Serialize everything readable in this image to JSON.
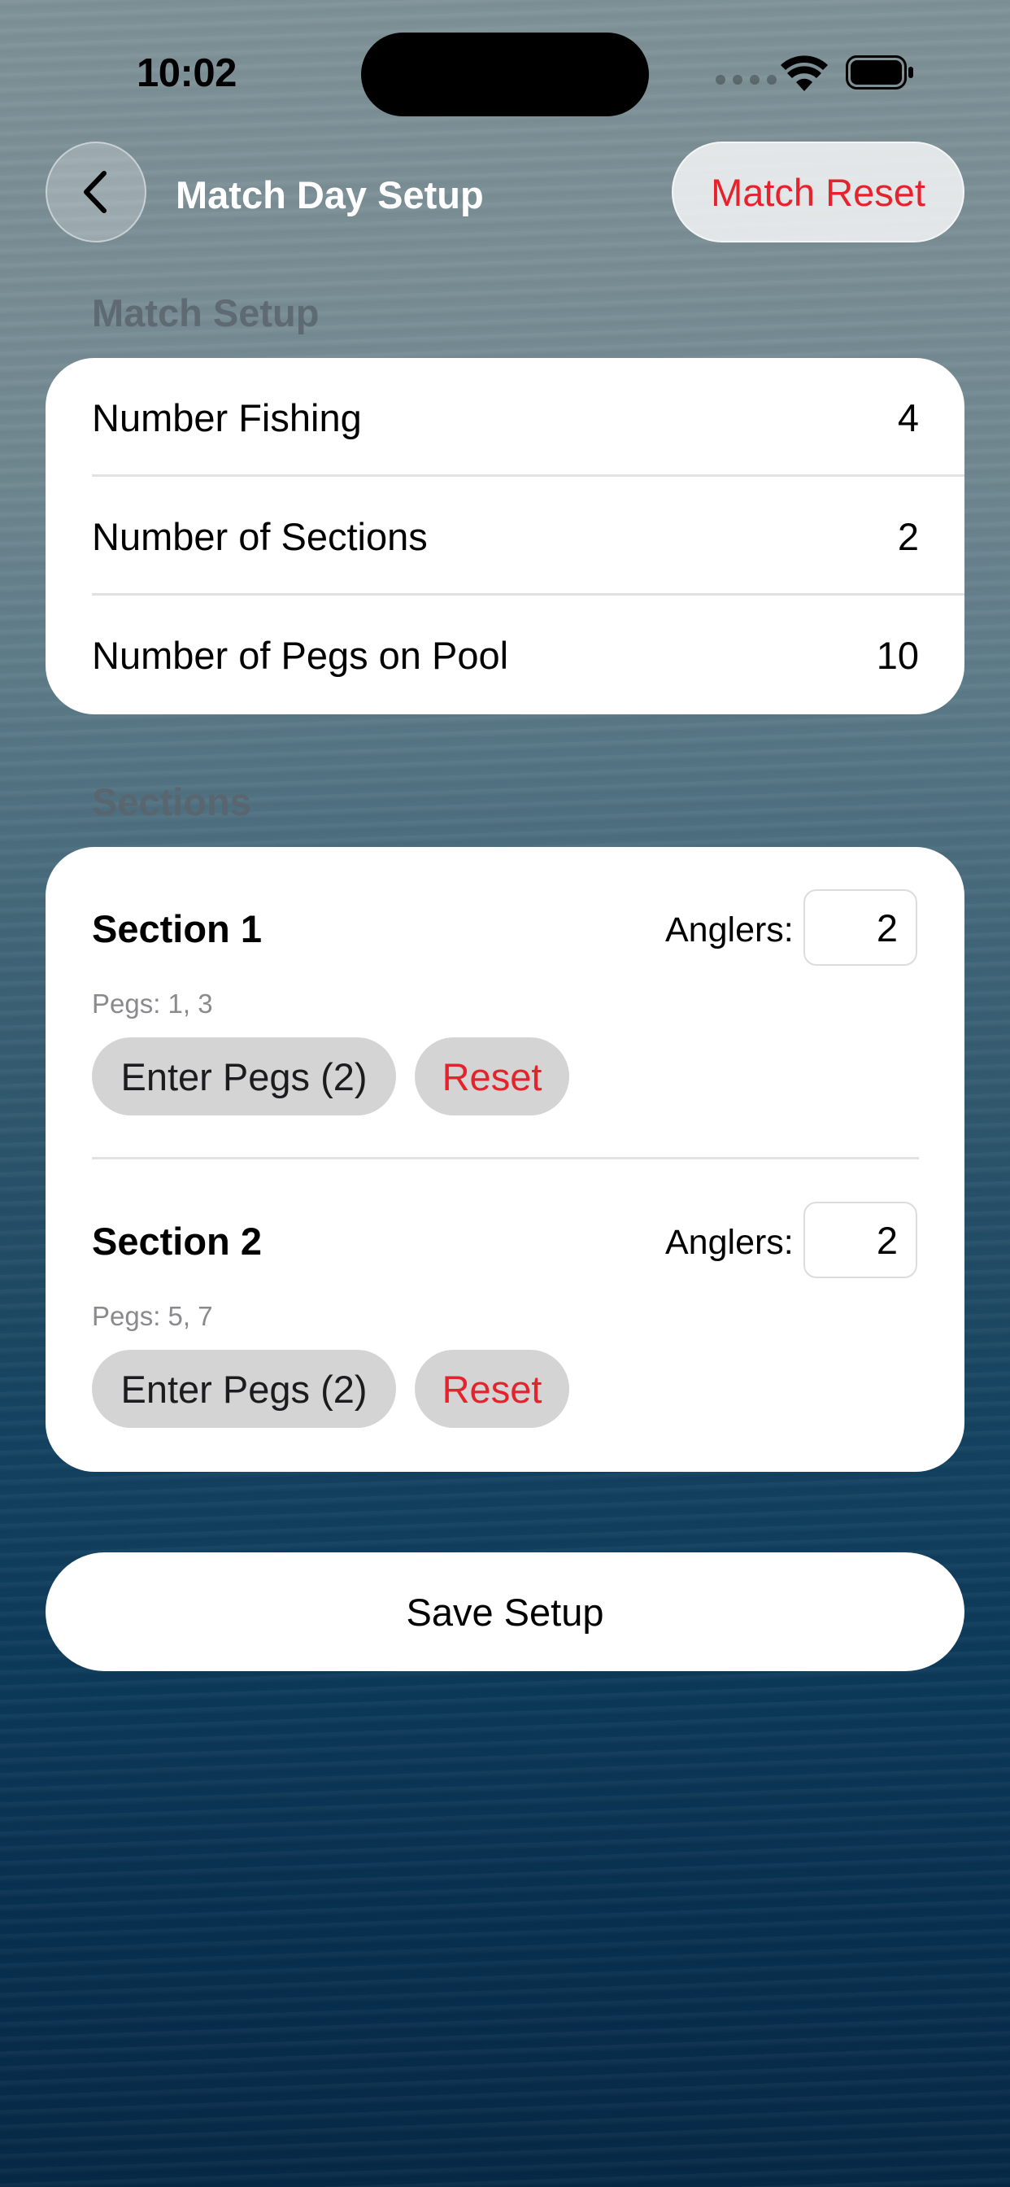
{
  "status_bar": {
    "time": "10:02"
  },
  "nav": {
    "title": "Match Day Setup",
    "reset_label": "Match Reset"
  },
  "match_setup": {
    "header": "Match Setup",
    "rows": [
      {
        "label": "Number Fishing",
        "value": "4"
      },
      {
        "label": "Number of Sections",
        "value": "2"
      },
      {
        "label": "Number of Pegs on Pool",
        "value": "10"
      }
    ]
  },
  "sections": {
    "header": "Sections",
    "items": [
      {
        "title": "Section 1",
        "anglers_label": "Anglers:",
        "anglers": "2",
        "pegs": "Pegs: 1, 3",
        "enter_label": "Enter Pegs (2)",
        "reset_label": "Reset"
      },
      {
        "title": "Section 2",
        "anglers_label": "Anglers:",
        "anglers": "2",
        "pegs": "Pegs: 5, 7",
        "enter_label": "Enter Pegs (2)",
        "reset_label": "Reset"
      }
    ]
  },
  "save_label": "Save Setup",
  "colors": {
    "destructive": "#e5232c",
    "card": "#ffffff",
    "pill": "#d4d4d4"
  },
  "icons": {
    "back": "chevron-left-icon",
    "wifi": "wifi-icon",
    "battery": "battery-icon",
    "signal": "cellular-signal-icon"
  }
}
